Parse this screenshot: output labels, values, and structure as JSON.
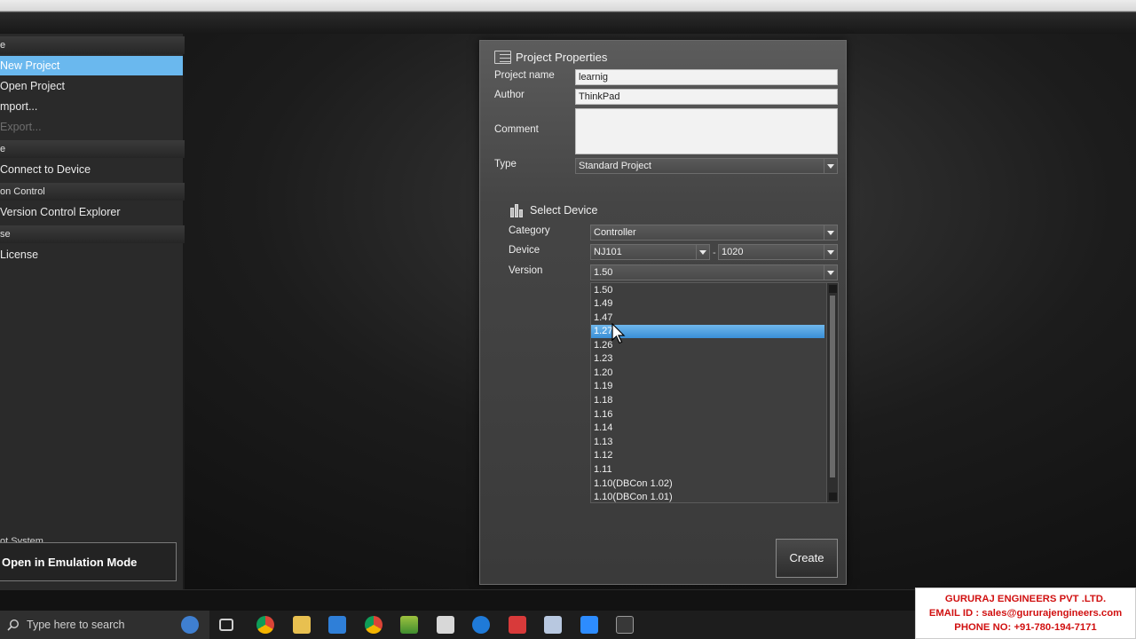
{
  "left_nav": {
    "headers": [
      {
        "label": "e"
      },
      {
        "label": "e"
      },
      {
        "label": "on Control"
      },
      {
        "label": "se"
      }
    ],
    "items": [
      {
        "label": "New Project",
        "selected": true
      },
      {
        "label": "Open Project"
      },
      {
        "label": "mport..."
      },
      {
        "label": "Export...",
        "disabled": true
      },
      {
        "label": "Connect to Device"
      },
      {
        "label": "Version Control Explorer"
      },
      {
        "label": "License"
      }
    ],
    "emulation": {
      "section_label": "ot System",
      "button_label": "Open in Emulation Mode"
    }
  },
  "dialog": {
    "title": "Project Properties",
    "fields": {
      "project_name": {
        "label": "Project name",
        "value": "learnig"
      },
      "author": {
        "label": "Author",
        "value": "ThinkPad"
      },
      "comment": {
        "label": "Comment",
        "value": ""
      },
      "type": {
        "label": "Type",
        "value": "Standard Project"
      }
    },
    "select_device": {
      "title": "Select Device",
      "category": {
        "label": "Category",
        "value": "Controller"
      },
      "device": {
        "label": "Device",
        "value": "NJ101",
        "sub_value": "1020",
        "separator": "-"
      },
      "version": {
        "label": "Version",
        "value": "1.50"
      }
    },
    "version_options": [
      "1.50",
      "1.49",
      "1.47",
      "1.27",
      "1.26",
      "1.23",
      "1.20",
      "1.19",
      "1.18",
      "1.16",
      "1.14",
      "1.13",
      "1.12",
      "1.11",
      "1.10(DBCon 1.02)",
      "1.10(DBCon 1.01)"
    ],
    "highlighted_option": "1.27",
    "create_label": "Create"
  },
  "taskbar": {
    "search_placeholder": "Type here to search",
    "icons": [
      "windows-search-icon",
      "task-view-icon",
      "chrome-icon",
      "file-explorer-icon",
      "mail-icon",
      "chrome-icon",
      "stack-app-icon",
      "notes-app-icon",
      "teamviewer-icon",
      "anydesk-icon",
      "computer-icon",
      "zoom-icon",
      "sysmac-studio-icon"
    ]
  },
  "watermark": {
    "line1": "GURURAJ ENGINEERS PVT .LTD.",
    "line2": "EMAIL ID : sales@gururajengineers.com",
    "line3": "PHONE NO: +91-780-194-7171"
  },
  "colors": {
    "selection_blue": "#6ab8ee",
    "watermark_red": "#d11111"
  }
}
